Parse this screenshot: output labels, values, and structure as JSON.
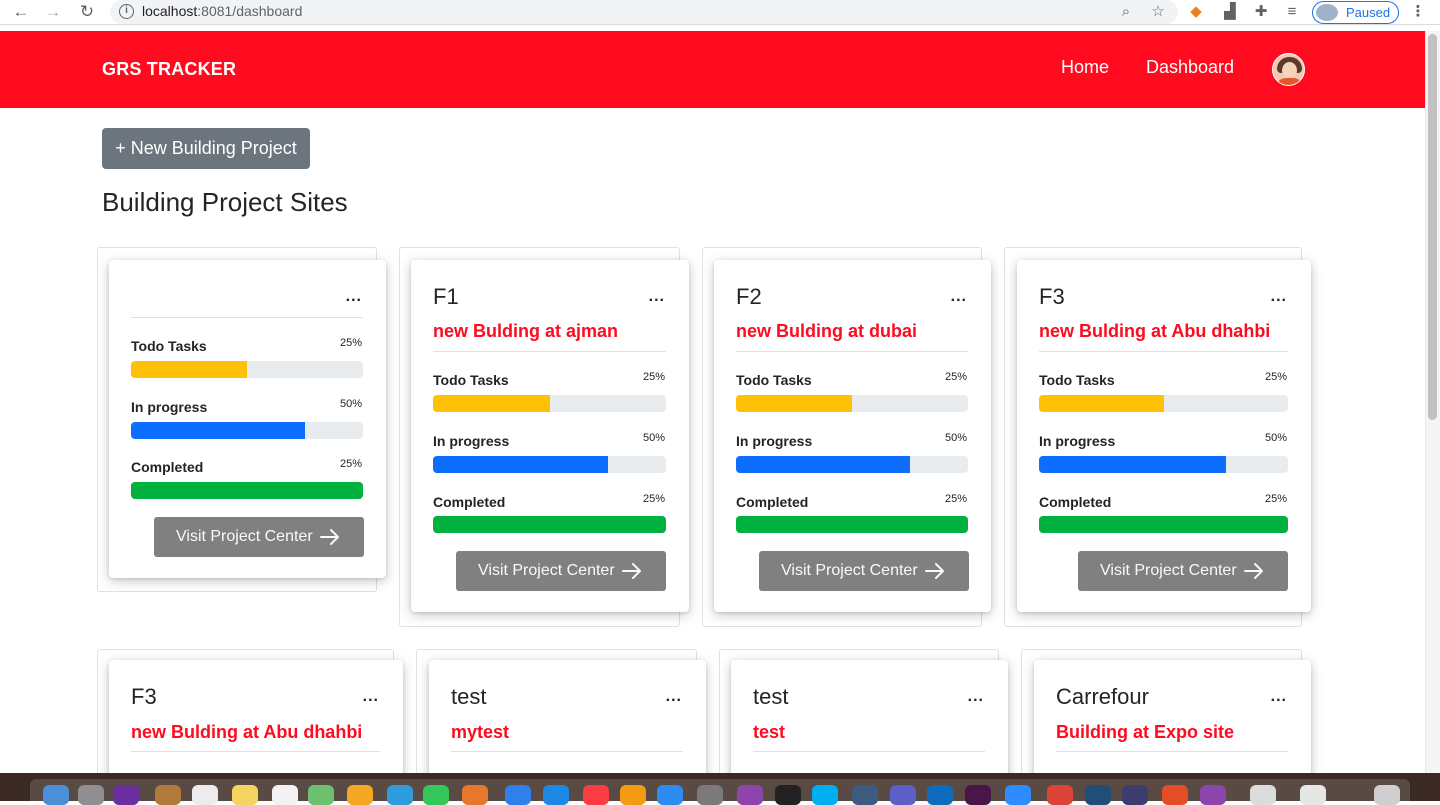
{
  "browser": {
    "url_host": "localhost",
    "url_path": ":8081/dashboard",
    "profile_label": "Paused"
  },
  "navbar": {
    "brand": "GRS TRACKER",
    "links": [
      "Home",
      "Dashboard"
    ]
  },
  "main": {
    "new_button": "+ New Building Project",
    "title": "Building Project Sites"
  },
  "labels": {
    "todo": "Todo Tasks",
    "progress": "In progress",
    "completed": "Completed",
    "visit": "Visit Project Center",
    "menu": "..."
  },
  "projects": [
    {
      "name": "",
      "subtitle": "",
      "todo_pct": "25%",
      "progress_pct": "50%",
      "completed_pct": "25%",
      "todo_fill": 0.5,
      "progress_fill": 0.75,
      "completed_fill": 1.0
    },
    {
      "name": "F1",
      "subtitle": "new Bulding at ajman",
      "todo_pct": "25%",
      "progress_pct": "50%",
      "completed_pct": "25%",
      "todo_fill": 0.5,
      "progress_fill": 0.75,
      "completed_fill": 1.0
    },
    {
      "name": "F2",
      "subtitle": "new Bulding at dubai",
      "todo_pct": "25%",
      "progress_pct": "50%",
      "completed_pct": "25%",
      "todo_fill": 0.5,
      "progress_fill": 0.75,
      "completed_fill": 1.0
    },
    {
      "name": "F3",
      "subtitle": "new Bulding at Abu dhahbi",
      "todo_pct": "25%",
      "progress_pct": "50%",
      "completed_pct": "25%",
      "todo_fill": 0.5,
      "progress_fill": 0.75,
      "completed_fill": 1.0
    },
    {
      "name": "F3",
      "subtitle": "new Bulding at Abu dhahbi"
    },
    {
      "name": "test",
      "subtitle": "mytest"
    },
    {
      "name": "test",
      "subtitle": "test"
    },
    {
      "name": "Carrefour",
      "subtitle": "Building at Expo site"
    }
  ],
  "colors": {
    "brand_red": "#ff0a1e",
    "todo": "#ffc107",
    "progress": "#0d6efd",
    "completed": "#00b140",
    "button_gray": "#808080"
  }
}
